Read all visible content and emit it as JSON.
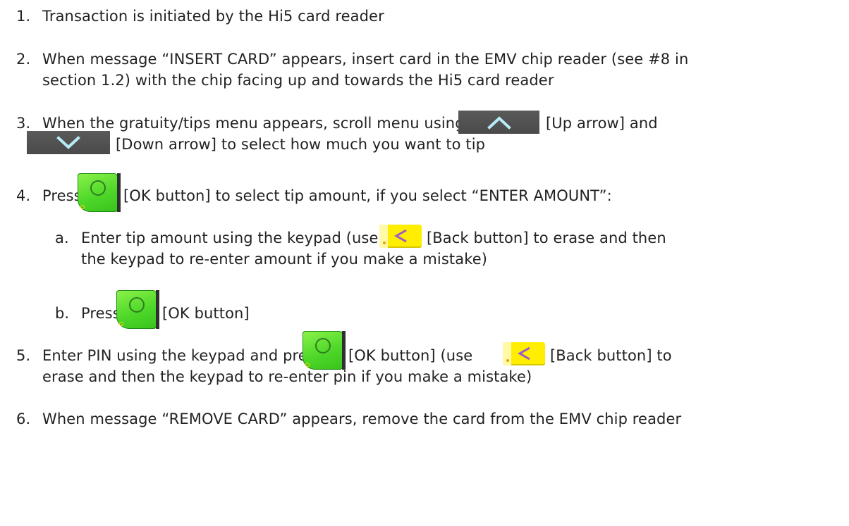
{
  "steps": [
    {
      "num": "1.",
      "text": "Transaction is initiated by the Hi5 card reader"
    },
    {
      "num": "2.",
      "line1": "When message “INSERT CARD” appears, insert card in the EMV chip reader (see #8 in",
      "line2": "section 1.2)  with the chip facing up and towards the Hi5 card reader"
    },
    {
      "num": "3.",
      "pre": "When the gratuity/tips menu appears, scroll menu using",
      "up_label": "[Up arrow] and",
      "down_label": "[Down arrow] to select how much you want to tip"
    },
    {
      "num": "4.",
      "pre": "Press",
      "post": "[OK button] to select tip amount, if you select “ENTER AMOUNT”:"
    },
    {
      "num": "a.",
      "pre": "Enter tip amount using the keypad (use",
      "post": "[Back button] to erase and then",
      "line2": "the keypad to re-enter amount if you make a mistake)"
    },
    {
      "num": "b.",
      "pre": "Press",
      "post": "[OK button]"
    },
    {
      "num": "5.",
      "pre": "Enter PIN using the keypad and press",
      "mid": "[OK button] (use",
      "post": "[Back button] to",
      "line2": "erase and then the keypad to re-enter pin if you make a mistake)"
    },
    {
      "num": "6.",
      "text": "When message “REMOVE CARD” appears, remove the card from the EMV chip reader"
    }
  ],
  "colors": {
    "ok_green": "#4fd82a",
    "back_yellow": "#ffee00",
    "arrow_gray": "#505050"
  },
  "icons": {
    "up": "chevron-up-icon",
    "down": "chevron-down-icon",
    "ok": "ok-button-icon",
    "back": "back-button-icon"
  }
}
